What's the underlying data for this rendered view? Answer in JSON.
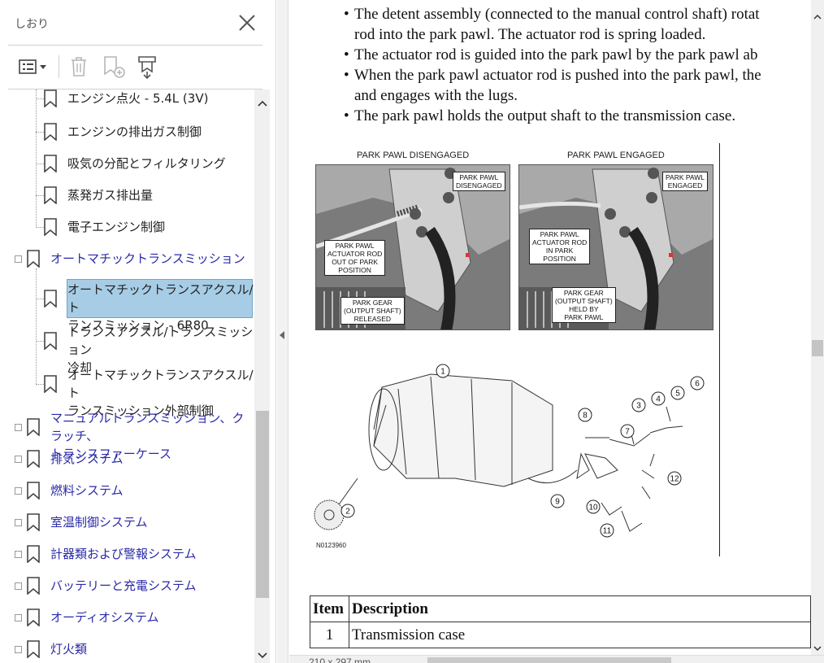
{
  "sidebar": {
    "title": "しおり",
    "toolbar": {
      "options_icon": "list-options-icon",
      "delete_icon": "trash-icon",
      "new_bookmark_icon": "add-bookmark-icon",
      "tagged_bookmark_icon": "tagged-bookmark-icon"
    },
    "items": [
      {
        "label": "エンジン点火 - 5.4L (3V)",
        "level": 1
      },
      {
        "label": "エンジンの排出ガス制御",
        "level": 1
      },
      {
        "label": "吸気の分配とフィルタリング",
        "level": 1
      },
      {
        "label": "蒸発ガス排出量",
        "level": 1
      },
      {
        "label": "電子エンジン制御",
        "level": 1
      },
      {
        "label": "オートマチックトランスミッション",
        "level": 0
      },
      {
        "label": "オートマチックトランスアクスル/ト\nランスミッション - 6R80",
        "level": 1,
        "selected": true
      },
      {
        "label": "トランスアクスル/トランスミッション\n冷却",
        "level": 1
      },
      {
        "label": "オートマチックトランスアクスル/ト\nランスミッション外部制御",
        "level": 1
      },
      {
        "label": "マニュアルトランスミッション、クラッチ、\nトランスファーケース",
        "level": 0
      },
      {
        "label": "排気システム",
        "level": 0
      },
      {
        "label": "燃料システム",
        "level": 0
      },
      {
        "label": "室温制御システム",
        "level": 0
      },
      {
        "label": "計器類および警報システム",
        "level": 0
      },
      {
        "label": "バッテリーと充電システム",
        "level": 0
      },
      {
        "label": "オーディオシステム",
        "level": 0
      },
      {
        "label": "灯火類",
        "level": 0
      }
    ]
  },
  "document": {
    "bullets": [
      {
        "line1": "The detent assembly (connected to the manual control shaft) rotat",
        "line2": "rod into the park pawl. The actuator rod is spring loaded."
      },
      {
        "line1": "The actuator rod is guided into the park pawl by the park pawl ab",
        "line2": ""
      },
      {
        "line1": "When the park pawl actuator rod is pushed into the park pawl, the",
        "line2": "and engages with the lugs."
      },
      {
        "line1": "The park pawl holds the output shaft to the transmission case.",
        "line2": ""
      }
    ],
    "figure": {
      "left_title": "PARK PAWL DISENGAGED",
      "right_title": "PARK PAWL  ENGAGED",
      "left_callouts": [
        "PARK PAWL\nDISENGAGED",
        "PARK PAWL\nACTUATOR ROD\nOUT OF PARK\nPOSITION",
        "PARK GEAR\n(OUTPUT SHAFT)\nRELEASED"
      ],
      "right_callouts": [
        "PARK PAWL\nENGAGED",
        "PARK PAWL\nACTUATOR ROD\nIN PARK\nPOSITION",
        "PARK GEAR\n(OUTPUT SHAFT)\nHELD BY\nPARK PAWL"
      ],
      "diagram_numbers": [
        "1",
        "2",
        "3",
        "4",
        "5",
        "6",
        "7",
        "8",
        "9",
        "10",
        "11",
        "12"
      ],
      "code": "N0123960"
    },
    "table": {
      "headers": [
        "Item",
        "Description"
      ],
      "rows": [
        [
          "1",
          "Transmission case"
        ]
      ]
    }
  },
  "status": {
    "page_size": "210 x 297 mm"
  }
}
